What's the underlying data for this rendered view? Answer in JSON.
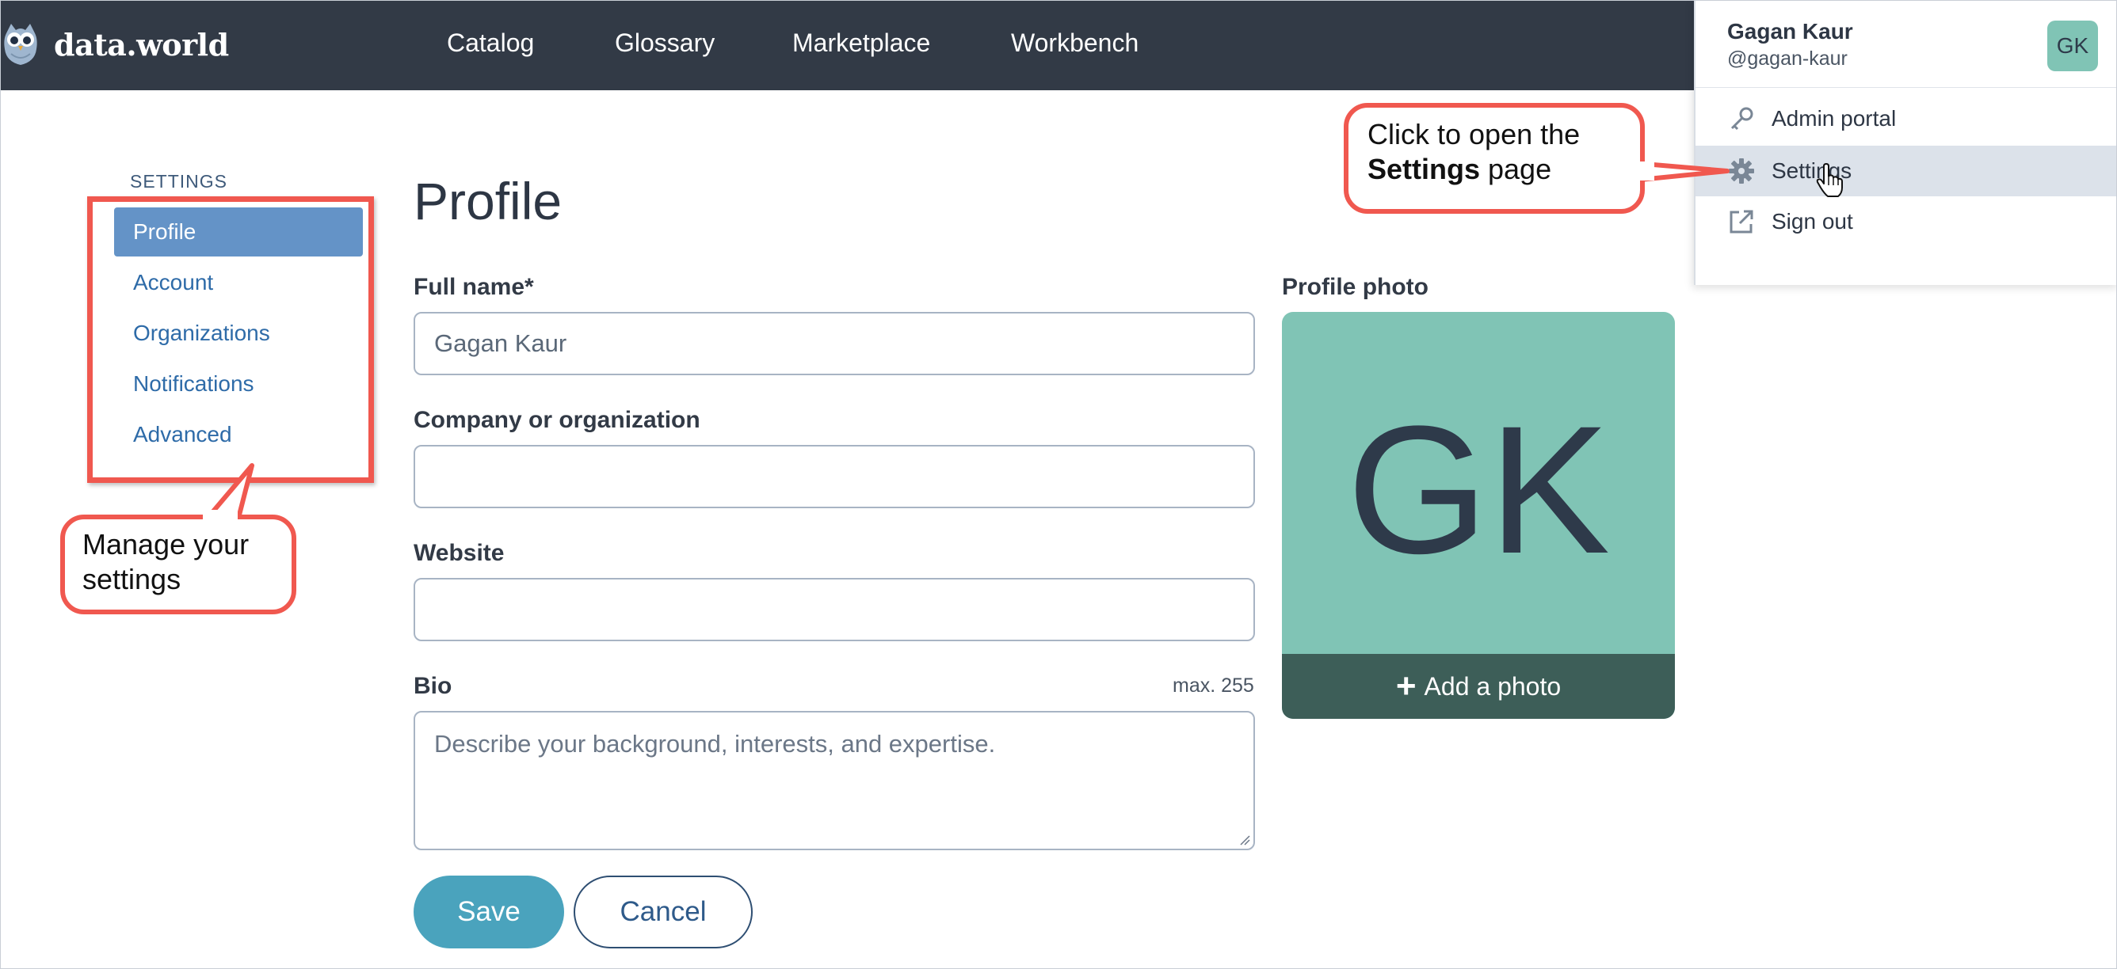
{
  "app": {
    "name": "data.world"
  },
  "nav": {
    "items": [
      "Catalog",
      "Glossary",
      "Marketplace",
      "Workbench"
    ]
  },
  "sidebar": {
    "heading": "SETTINGS",
    "items": [
      {
        "label": "Profile",
        "active": true
      },
      {
        "label": "Account"
      },
      {
        "label": "Organizations"
      },
      {
        "label": "Notifications"
      },
      {
        "label": "Advanced"
      }
    ]
  },
  "page": {
    "title": "Profile"
  },
  "form": {
    "full_name_label": "Full name*",
    "full_name_value": "Gagan Kaur",
    "company_label": "Company or organization",
    "company_value": "",
    "website_label": "Website",
    "website_value": "",
    "bio_label": "Bio",
    "bio_max": "max. 255",
    "bio_placeholder": "Describe your background, interests, and expertise.",
    "save_label": "Save",
    "cancel_label": "Cancel"
  },
  "photo": {
    "label": "Profile photo",
    "initials": "GK",
    "add_label": "Add a photo",
    "bg_color": "#80c4b5"
  },
  "user_menu": {
    "name": "Gagan Kaur",
    "handle": "@gagan-kaur",
    "initials": "GK",
    "items": [
      {
        "label": "Admin portal",
        "icon": "key-icon"
      },
      {
        "label": "Settings",
        "icon": "gear-icon",
        "highlighted": true
      },
      {
        "label": "Sign out",
        "icon": "external-link-icon"
      }
    ]
  },
  "callouts": {
    "settings": {
      "line1": "Click to open the",
      "bold": "Settings",
      "rest": " page"
    },
    "sidebar": {
      "line1": "Manage your",
      "line2": "settings"
    }
  },
  "colors": {
    "navbar": "#323a46",
    "accent": "#4aa3bd",
    "sidebar_active": "#6493c7",
    "callout_border": "#f0584f"
  }
}
